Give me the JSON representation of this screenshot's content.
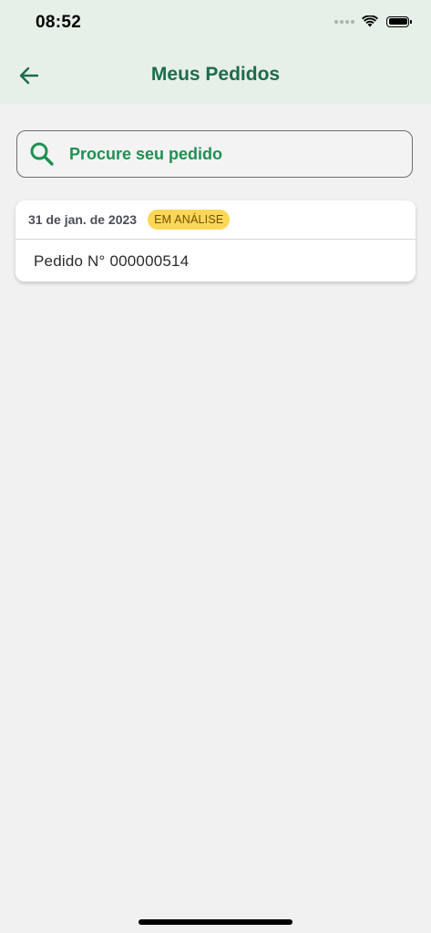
{
  "status_bar": {
    "time": "08:52"
  },
  "header": {
    "title": "Meus Pedidos",
    "back_icon": "arrow-left-icon"
  },
  "search": {
    "placeholder": "Procure seu pedido",
    "icon": "search-icon"
  },
  "orders": [
    {
      "date": "31 de jan. de 2023",
      "status": "EM ANÁLISE",
      "number_label": "Pedido N° 000000514"
    }
  ],
  "colors": {
    "header_bg": "#e6f0e6",
    "title": "#1d6b4c",
    "accent": "#1f9052",
    "badge_bg": "#fcd757",
    "badge_text": "#6e5107",
    "page_bg": "#f1f1f1"
  }
}
